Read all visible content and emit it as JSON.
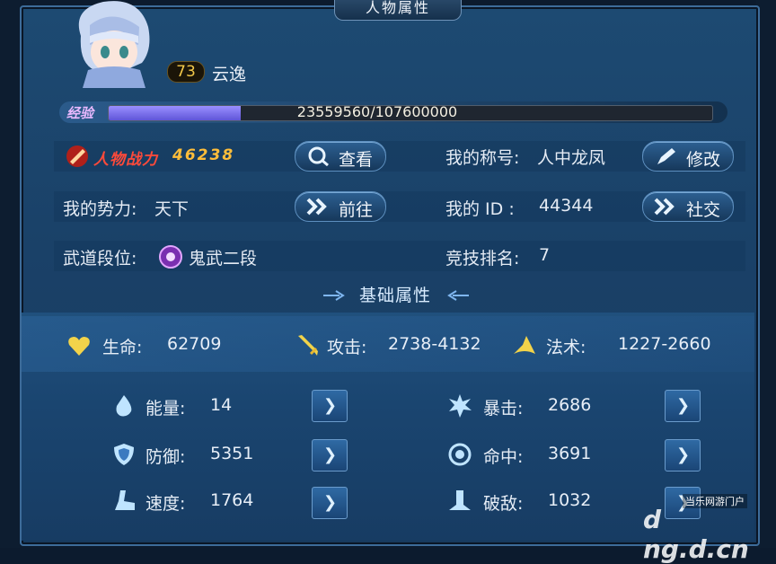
{
  "window": {
    "title": "人物属性"
  },
  "profile": {
    "level": "73",
    "name": "云逸"
  },
  "exp": {
    "label": "经验",
    "text": "23559560/107600000",
    "current": 23559560,
    "max": 107600000
  },
  "power": {
    "label": "人物战力",
    "value": "46238"
  },
  "buttons": {
    "view": "查看",
    "modify": "修改",
    "goto": "前往",
    "social": "社交"
  },
  "info": {
    "title_label": "我的称号:",
    "title_value": "人中龙凤",
    "faction_label": "我的势力:",
    "faction_value": "天下",
    "id_label": "我的 ID :",
    "id_value": "44344",
    "rank_label": "武道段位:",
    "rank_value": "鬼武二段",
    "arena_label": "竞技排名:",
    "arena_value": "7"
  },
  "section": {
    "title": "基础属性"
  },
  "main_stats": [
    {
      "label": "生命:",
      "value": "62709",
      "icon": "heart-icon"
    },
    {
      "label": "攻击:",
      "value": "2738-4132",
      "icon": "sword-icon"
    },
    {
      "label": "法术:",
      "value": "1227-2660",
      "icon": "wizard-hat-icon"
    }
  ],
  "stats": [
    {
      "label": "能量:",
      "value": "14",
      "icon": "energy-drop-icon"
    },
    {
      "label": "暴击:",
      "value": "2686",
      "icon": "crit-burst-icon"
    },
    {
      "label": "防御:",
      "value": "5351",
      "icon": "shield-icon"
    },
    {
      "label": "命中:",
      "value": "3691",
      "icon": "target-icon"
    },
    {
      "label": "速度:",
      "value": "1764",
      "icon": "speed-boot-icon"
    },
    {
      "label": "破敌:",
      "value": "1032",
      "icon": "break-icon"
    }
  ],
  "watermark": {
    "small": "当乐网游门户",
    "big": "d ng.d.cn"
  },
  "colors": {
    "accent": "#5f55d8",
    "power": "#ff4a3a",
    "power_value": "#ffbe3a",
    "level": "#f4c94a"
  }
}
